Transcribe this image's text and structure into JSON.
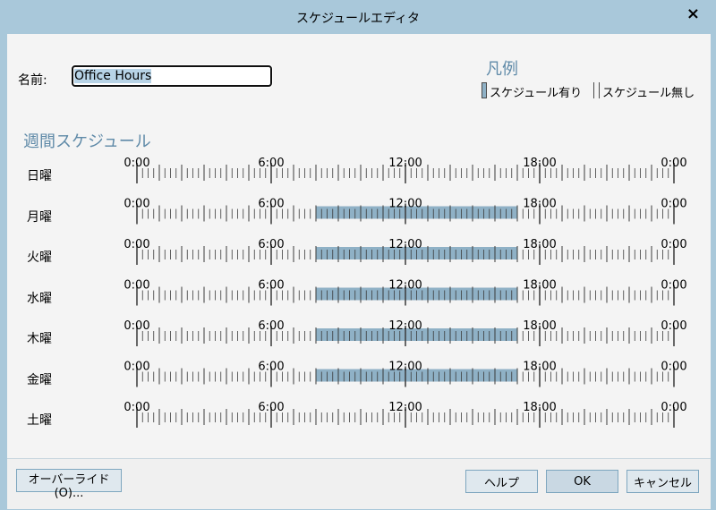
{
  "window": {
    "title": "スケジュールエディタ",
    "close_icon": "×"
  },
  "name_field": {
    "label": "名前:",
    "value": "Office Hours"
  },
  "legend": {
    "title": "凡例",
    "scheduled_label": "スケジュール有り",
    "unscheduled_label": "スケジュール無し"
  },
  "schedule": {
    "title": "週間スケジュール",
    "time_labels": [
      "0:00",
      "6:00",
      "12:00",
      "18:00",
      "0:00"
    ],
    "colors": {
      "scheduled": "#8fb1c6",
      "tick": "#3a3a3a"
    },
    "days": [
      {
        "label": "日曜",
        "scheduled": []
      },
      {
        "label": "月曜",
        "scheduled": [
          [
            8.0,
            17.0
          ]
        ]
      },
      {
        "label": "火曜",
        "scheduled": [
          [
            8.0,
            17.0
          ]
        ]
      },
      {
        "label": "水曜",
        "scheduled": [
          [
            8.0,
            17.0
          ]
        ]
      },
      {
        "label": "木曜",
        "scheduled": [
          [
            8.0,
            17.0
          ]
        ]
      },
      {
        "label": "金曜",
        "scheduled": [
          [
            8.0,
            17.0
          ]
        ]
      },
      {
        "label": "土曜",
        "scheduled": []
      }
    ]
  },
  "buttons": {
    "override": "オーバーライド(O)...",
    "help": "ヘルプ",
    "ok": "OK",
    "cancel": "キャンセル"
  }
}
